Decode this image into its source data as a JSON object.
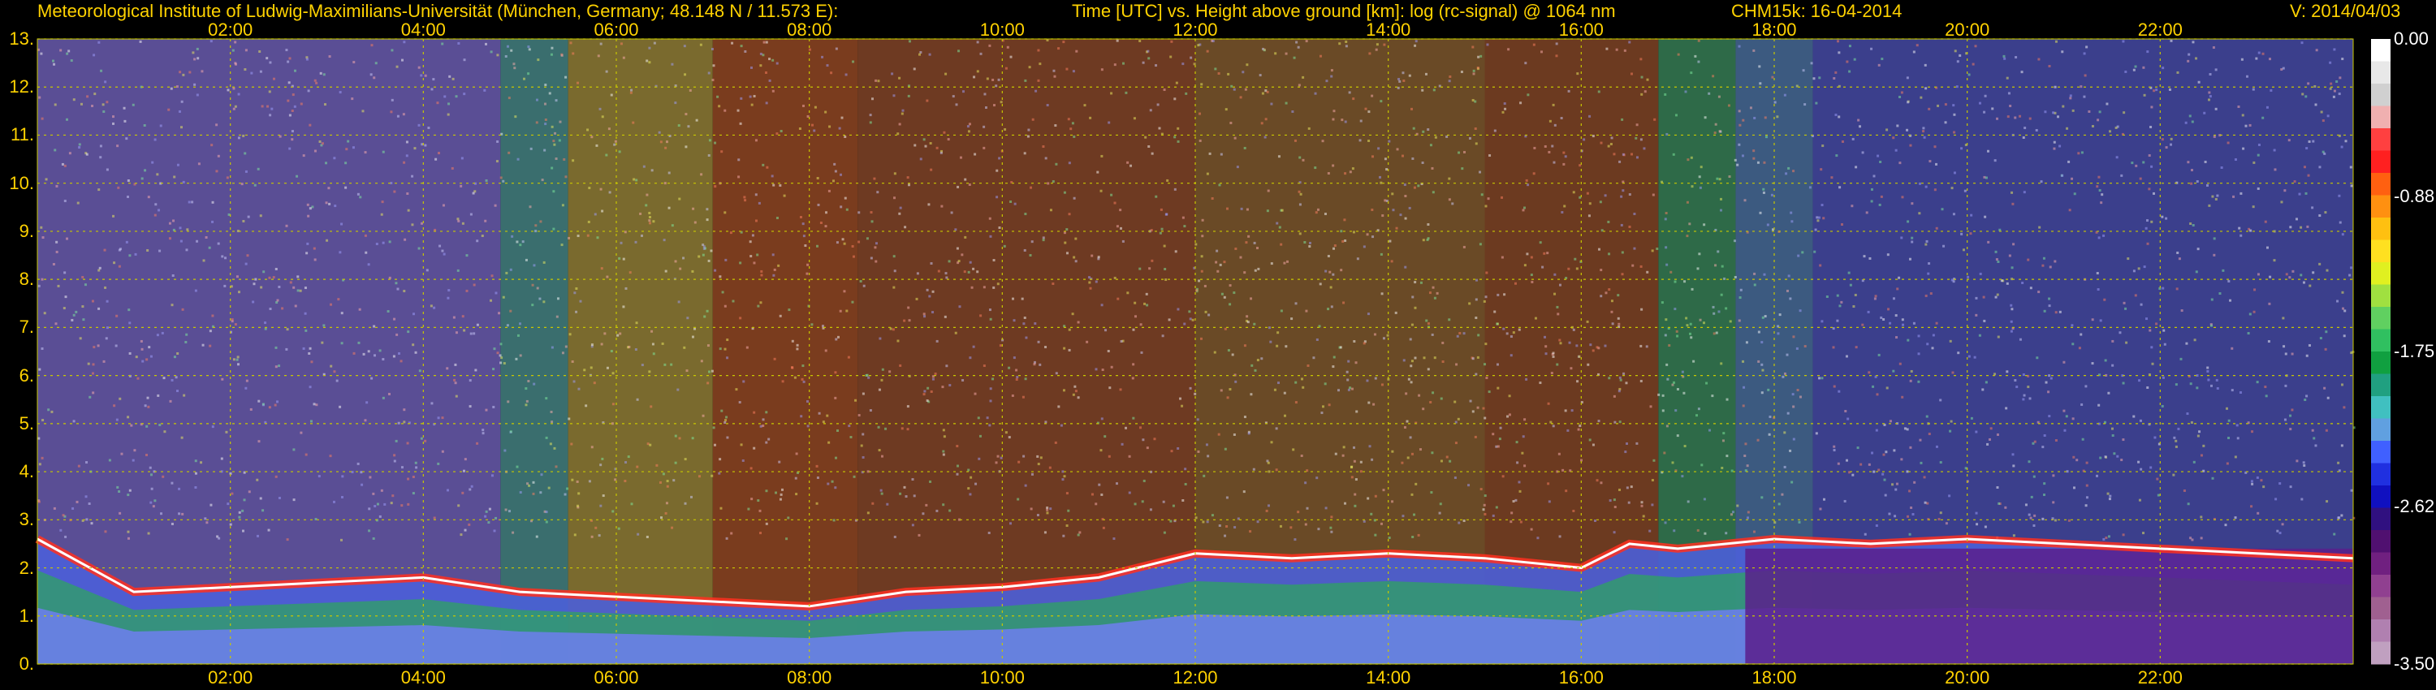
{
  "header": {
    "institute": "Meteorological Institute of Ludwig-Maximilians-Universität (München, Germany; 48.148 N / 11.573 E):",
    "axis_desc": "Time [UTC] vs. Height above ground [km]: log (rc-signal) @ 1064 nm",
    "instrument": "CHM15k: 16-04-2014",
    "version": "V: 2014/04/03"
  },
  "chart_data": {
    "type": "heatmap",
    "title": "Time [UTC] vs. Height above ground [km]: log (rc-signal) @ 1064 nm",
    "x_tick_labels": [
      "02:00",
      "04:00",
      "06:00",
      "08:00",
      "10:00",
      "12:00",
      "14:00",
      "16:00",
      "18:00",
      "20:00",
      "22:00"
    ],
    "x_ticks_hours": [
      2,
      4,
      6,
      8,
      10,
      12,
      14,
      16,
      18,
      20,
      22
    ],
    "xlim_hours": [
      0,
      24
    ],
    "y_tick_labels": [
      "0.",
      "1.",
      "2.",
      "3.",
      "4.",
      "5.",
      "6.",
      "7.",
      "8.",
      "9.",
      "10.",
      "11.",
      "12.",
      "13."
    ],
    "ylim_km": [
      0,
      13
    ],
    "grid": true,
    "colorbar": {
      "range": [
        -3.5,
        0.0
      ],
      "tick_labels": [
        "0.00",
        "-0.88",
        "-1.75",
        "-2.62",
        "-3.50"
      ],
      "tick_values": [
        0.0,
        -0.88,
        -1.75,
        -2.62,
        -3.5
      ]
    },
    "features": {
      "aerosol_layer_top_km": [
        [
          0.0,
          2.6
        ],
        [
          1.0,
          1.5
        ],
        [
          2.0,
          1.6
        ],
        [
          3.0,
          1.7
        ],
        [
          4.0,
          1.8
        ],
        [
          5.0,
          1.5
        ],
        [
          6.0,
          1.4
        ],
        [
          7.0,
          1.3
        ],
        [
          8.0,
          1.2
        ],
        [
          9.0,
          1.5
        ],
        [
          10.0,
          1.6
        ],
        [
          11.0,
          1.8
        ],
        [
          12.0,
          2.3
        ],
        [
          13.0,
          2.2
        ],
        [
          14.0,
          2.3
        ],
        [
          15.0,
          2.2
        ],
        [
          16.0,
          2.0
        ],
        [
          16.5,
          2.5
        ],
        [
          17.0,
          2.4
        ],
        [
          18.0,
          2.6
        ],
        [
          19.0,
          2.5
        ],
        [
          20.0,
          2.6
        ],
        [
          21.0,
          2.5
        ],
        [
          22.0,
          2.4
        ],
        [
          23.0,
          2.3
        ],
        [
          24.0,
          2.2
        ]
      ]
    }
  }
}
